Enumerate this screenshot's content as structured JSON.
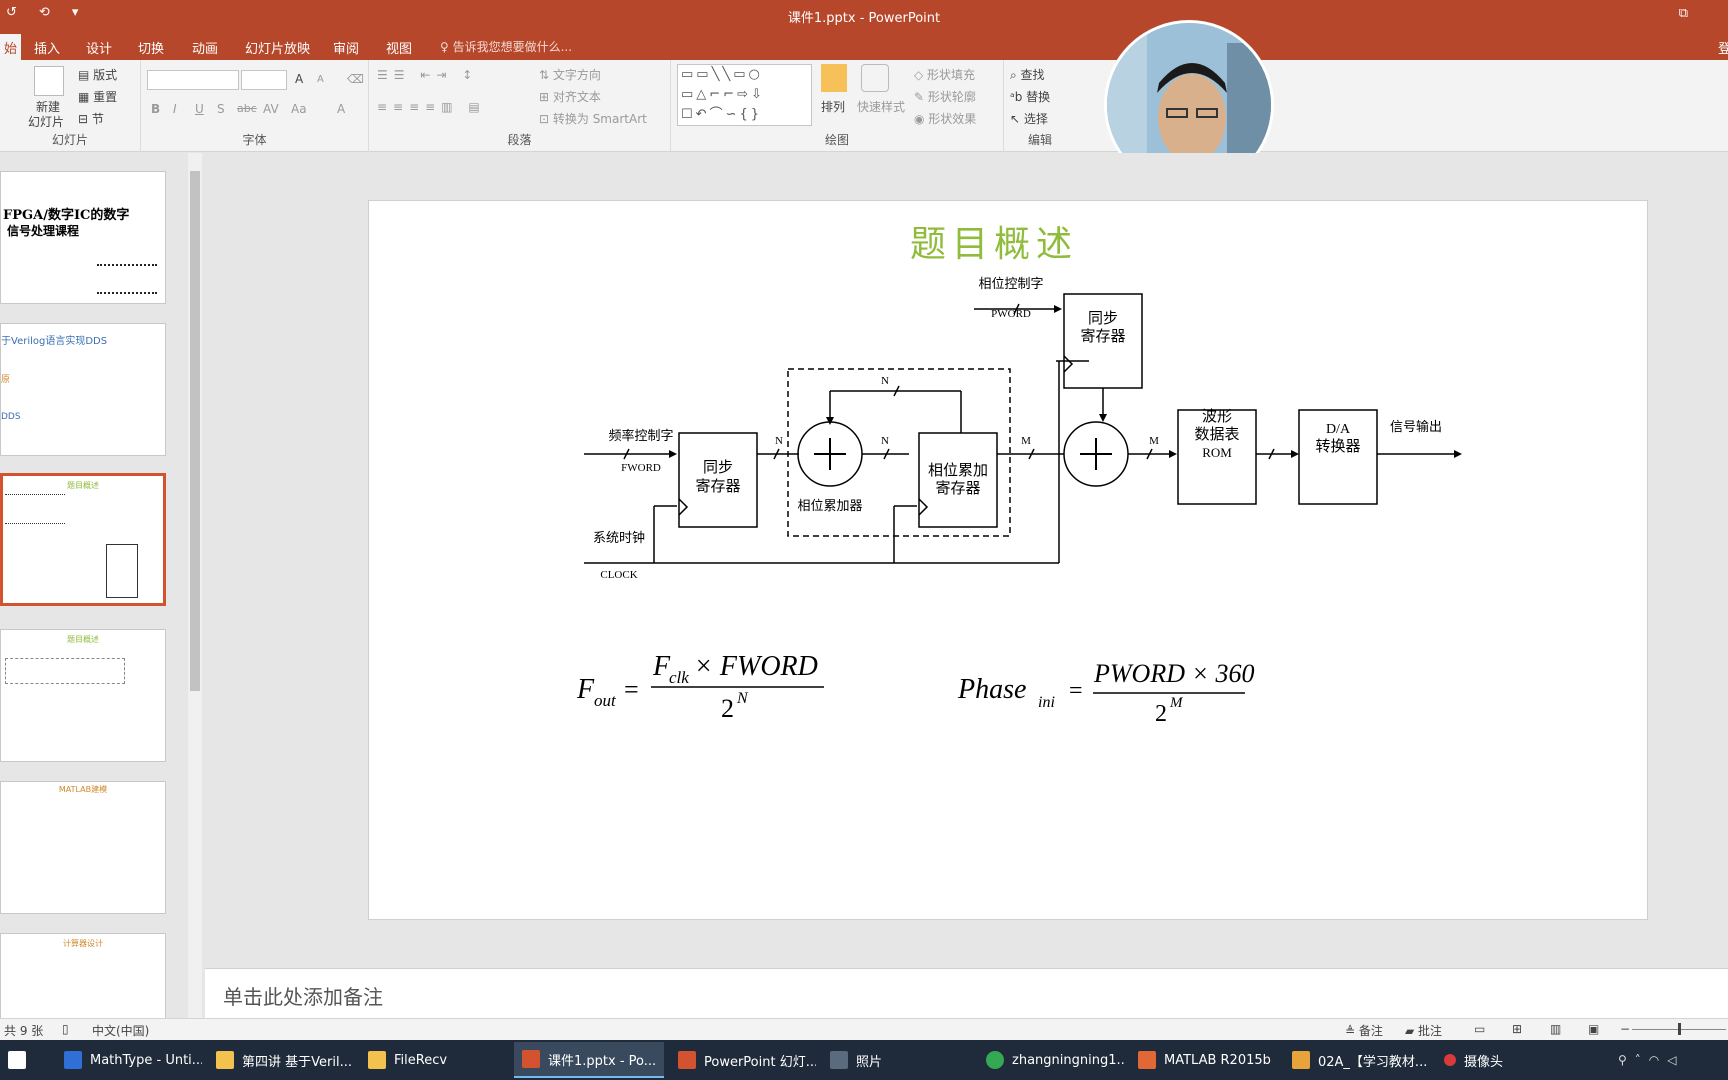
{
  "app": {
    "window_title": "课件1.pptx - PowerPoint",
    "qat": [
      "↺",
      "⟲",
      "▾"
    ],
    "window_buttons": [
      "⧉",
      "—",
      "✕"
    ]
  },
  "ribbon_tabs": [
    {
      "label": "始",
      "active": true
    },
    {
      "label": "插入"
    },
    {
      "label": "设计"
    },
    {
      "label": "切换"
    },
    {
      "label": "动画"
    },
    {
      "label": "幻灯片放映"
    },
    {
      "label": "审阅"
    },
    {
      "label": "视图"
    }
  ],
  "tell_me": "告诉我您想要做什么...",
  "account_label": "登",
  "ribbon": {
    "slides": {
      "new_slide_line1": "新建",
      "new_slide_line2": "幻灯片",
      "layout": "版式",
      "reset": "重置",
      "section": "节",
      "group": "幻灯片"
    },
    "font": {
      "bold": "B",
      "italic": "I",
      "underline": "U",
      "shadow": "S",
      "strike": "abc",
      "spacing": "AV",
      "case": "Aa",
      "grow": "A",
      "shrink": "A",
      "color": "A",
      "group": "字体"
    },
    "paragraph": {
      "text_direction": "文字方向",
      "align_text": "对齐文本",
      "smartart": "转换为 SmartArt",
      "group": "段落"
    },
    "drawing": {
      "arrange": "排列",
      "quick_styles": "快速样式",
      "fill": "形状填充",
      "outline": "形状轮廓",
      "effects": "形状效果",
      "group": "绘图"
    },
    "editing": {
      "find": "查找",
      "replace": "替换",
      "select": "选择",
      "group": "编辑"
    }
  },
  "thumbnails": [
    {
      "title_line1": "FPGA/数字IC的数字",
      "title_line2": "信号处理课程"
    },
    {
      "line1": "于Verilog语言实现DDS",
      "line2": "原",
      "line3": "DDS"
    },
    {
      "title": "题目概述"
    },
    {
      "title": "题目概述"
    },
    {
      "title": "MATLAB建模"
    },
    {
      "title": "计算器设计"
    }
  ],
  "slide": {
    "title": "题目概述",
    "diagram": {
      "freq_word_label": "频率控制字",
      "fword": "FWORD",
      "sys_clock_label": "系统时钟",
      "clock": "CLOCK",
      "sync_reg1_line1": "同步",
      "sync_reg1_line2": "寄存器",
      "adder_symbol": "+",
      "phase_acc_label": "相位累加器",
      "phase_acc_reg_line1": "相位累加",
      "phase_acc_reg_line2": "寄存器",
      "phase_word_label": "相位控制字",
      "pword": "PWORD",
      "sync_reg2_line1": "同步",
      "sync_reg2_line2": "寄存器",
      "rom_line1": "波形",
      "rom_line2": "数据表",
      "rom_line3": "ROM",
      "da_line1": "D/A",
      "da_line2": "转换器",
      "output_label": "信号输出",
      "bus_n": "N",
      "bus_m": "M"
    },
    "formula1": {
      "lhs": "F",
      "lhs_sub": "out",
      "num_a": "F",
      "num_a_sub": "clk",
      "num_b": " × FWORD",
      "den": "2",
      "den_exp": "N"
    },
    "formula2": {
      "lhs": "Phase",
      "lhs_sub": "ini",
      "num": "PWORD × 360",
      "den": "2",
      "den_exp": "M"
    }
  },
  "notes_placeholder": "单击此处添加备注",
  "status": {
    "slide_count": "共 9 张",
    "language": "中文(中国)",
    "notes": "备注",
    "comments": "批注"
  },
  "taskbar": [
    {
      "label": "MathType - Unti...",
      "color": "#2f6fd6"
    },
    {
      "label": "第四讲 基于Veril...",
      "color": "#f2c14e"
    },
    {
      "label": "FileRecv",
      "color": "#f2c14e"
    },
    {
      "label": "课件1.pptx - Po...",
      "color": "#d35230",
      "active": true
    },
    {
      "label": "PowerPoint 幻灯...",
      "color": "#d35230"
    },
    {
      "label": "照片",
      "color": "#5a6b7d"
    },
    {
      "label": "zhangningning1...",
      "color": "#34a853"
    },
    {
      "label": "MATLAB R2015b",
      "color": "#e16737"
    },
    {
      "label": "02A_【学习教材...",
      "color": "#e8a33a"
    },
    {
      "label": "摄像头",
      "color": "#d83b3b"
    }
  ]
}
